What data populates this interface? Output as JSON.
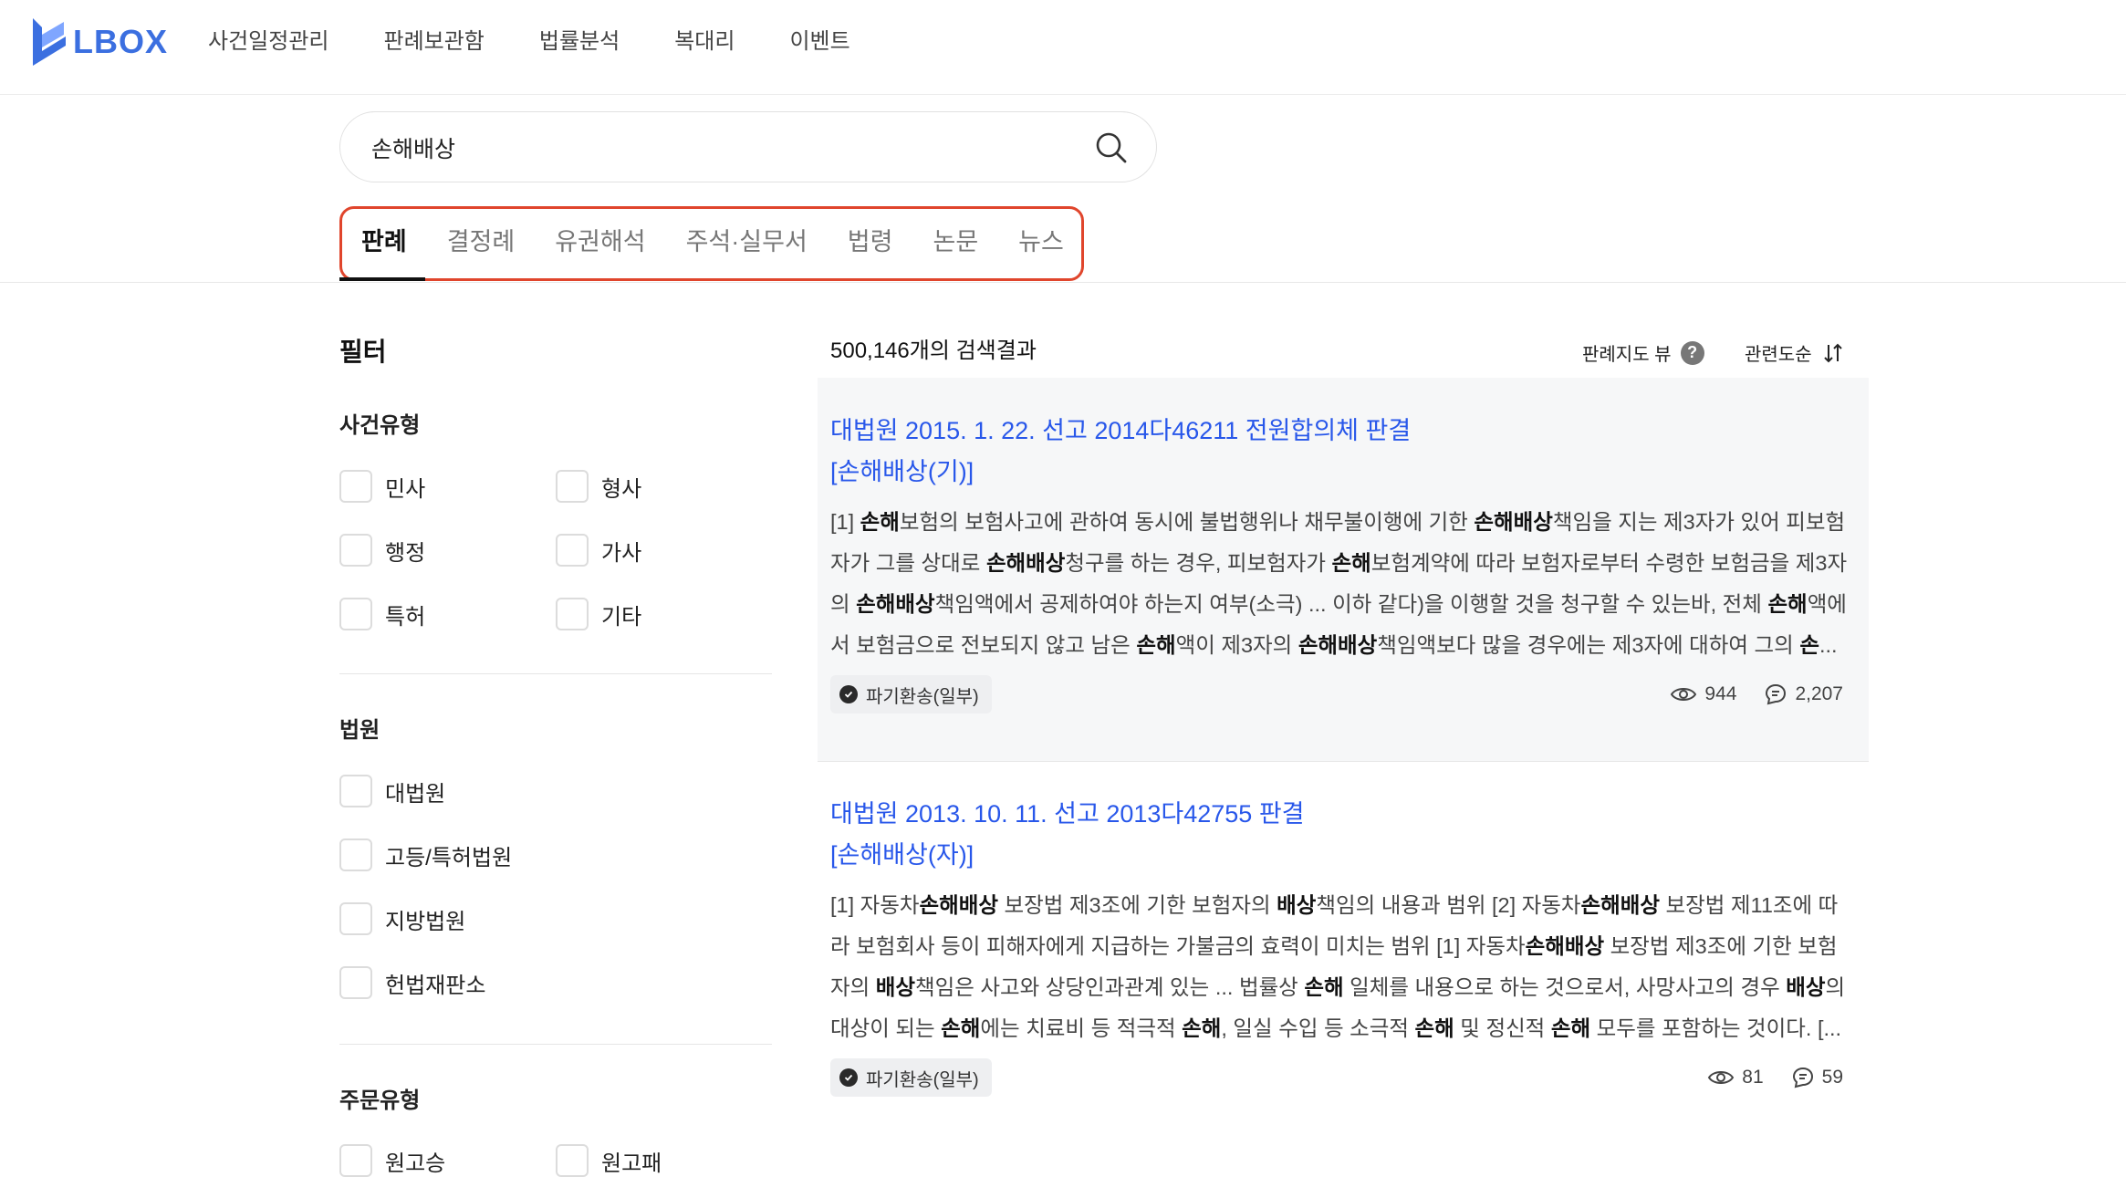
{
  "brand": {
    "name": "LBOX",
    "color": "#3b6fe0"
  },
  "nav": [
    "사건일정관리",
    "판례보관함",
    "법률분석",
    "복대리",
    "이벤트"
  ],
  "search": {
    "value": "손해배상",
    "icon": "search-icon"
  },
  "tabs": [
    "판례",
    "결정례",
    "유권해석",
    "주석·실무서",
    "법령",
    "논문",
    "뉴스"
  ],
  "highlight_color": "#e0452c",
  "filter": {
    "title": "필터",
    "groups": [
      {
        "title": "사건유형",
        "options": [
          "민사",
          "형사",
          "행정",
          "가사",
          "특허",
          "기타"
        ]
      },
      {
        "title": "법원",
        "options": [
          "대법원",
          "고등/특허법원",
          "지방법원",
          "헌법재판소"
        ]
      },
      {
        "title": "주문유형",
        "options": [
          "원고승",
          "원고패"
        ]
      }
    ]
  },
  "results": {
    "count_text": "500,146개의 검색결과",
    "view_toggle": "판례지도 뷰",
    "help_icon": "?",
    "sort_label": "관련도순",
    "items": [
      {
        "title": "대법원 2015. 1. 22. 선고 2014다46211 전원합의체 판결",
        "subtitle": "[손해배상(기)]",
        "snippet": "[1] <b>손해</b>보험의 보험사고에 관하여 동시에 불법행위나 채무불이행에 기한 <b>손해배상</b>책임을 지는 제3자가 있어 피보험자가 그를 상대로 <b>손해배상</b>청구를 하는 경우, 피보험자가 <b>손해</b>보험계약에 따라 보험자로부터 수령한 보험금을 제3자의 <b>손해배상</b>책임액에서 공제하여야 하는지 여부(소극) ... 이하 같다)을 이행할 것을 청구할 수 있는바, 전체 <b>손해</b>액에서 보험금으로 전보되지 않고 남은 <b>손해</b>액이 제3자의 <b>손해배상</b>책임액보다 많을 경우에는 제3자에 대하여 그의 <b>손</b>...",
        "badge": "파기환송(일부)",
        "views": "944",
        "comments": "2,207"
      },
      {
        "title": "대법원 2013. 10. 11. 선고 2013다42755 판결",
        "subtitle": "[손해배상(자)]",
        "snippet": "[1] 자동차<b>손해배상</b> 보장법 제3조에 기한 보험자의 <b>배상</b>책임의 내용과 범위 [2] 자동차<b>손해배상</b> 보장법 제11조에 따라 보험회사 등이 피해자에게 지급하는 가불금의 효력이 미치는 범위 [1] 자동차<b>손해배상</b> 보장법 제3조에 기한 보험자의 <b>배상</b>책임은 사고와 상당인과관계 있는 ... 법률상 <b>손해</b> 일체를 내용으로 하는 것으로서, 사망사고의 경우 <b>배상</b>의 대상이 되는 <b>손해</b>에는 치료비 등 적극적 <b>손해</b>, 일실 수입 등 소극적 <b>손해</b> 및 정신적 <b>손해</b> 모두를 포함하는 것이다. [...",
        "badge": "파기환송(일부)",
        "views": "81",
        "comments": "59"
      }
    ]
  }
}
